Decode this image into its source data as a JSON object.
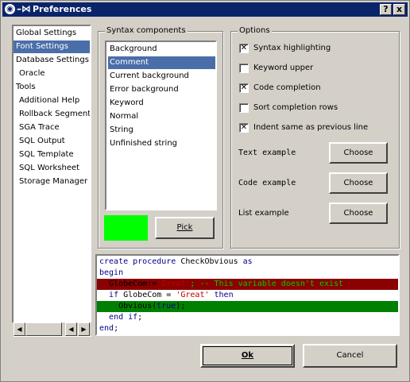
{
  "window": {
    "title": "Preferences",
    "help_button": "?",
    "close_button": "x"
  },
  "nav": {
    "items": [
      {
        "label": "Global Settings"
      },
      {
        "label": "Font Settings"
      },
      {
        "label": "Database Settings"
      },
      {
        "label": "Oracle"
      },
      {
        "label": "Tools"
      },
      {
        "label": "Additional Help"
      },
      {
        "label": "Rollback Segments"
      },
      {
        "label": "SGA Trace"
      },
      {
        "label": "SQL Output"
      },
      {
        "label": "SQL Template"
      },
      {
        "label": "SQL Worksheet"
      },
      {
        "label": "Storage Manager"
      }
    ],
    "selected": "Font Settings"
  },
  "syntax": {
    "group_title": "Syntax components",
    "items": [
      {
        "label": "Background"
      },
      {
        "label": "Comment"
      },
      {
        "label": "Current background"
      },
      {
        "label": "Error background"
      },
      {
        "label": "Keyword"
      },
      {
        "label": "Normal"
      },
      {
        "label": "String"
      },
      {
        "label": "Unfinished string"
      }
    ],
    "selected": "Comment",
    "color_swatch": "#00ff00",
    "pick_label": "Pick"
  },
  "options": {
    "group_title": "Options",
    "checkboxes": [
      {
        "label": "Syntax highlighting",
        "checked": true
      },
      {
        "label": "Keyword upper",
        "checked": false
      },
      {
        "label": "Code completion",
        "checked": true
      },
      {
        "label": "Sort completion rows",
        "checked": false
      },
      {
        "label": "Indent same as previous line",
        "checked": true
      }
    ],
    "text_example_label": "Text example",
    "code_example_label": "Code example",
    "list_example_label": "List example",
    "choose_label": "Choose"
  },
  "preview": {
    "lines": [
      {
        "kind": "normal",
        "segments": [
          {
            "t": "create procedure ",
            "c": "kw"
          },
          {
            "t": "CheckObvious ",
            "c": ""
          },
          {
            "t": "as",
            "c": "kw"
          }
        ]
      },
      {
        "kind": "normal",
        "segments": [
          {
            "t": "begin",
            "c": "kw"
          }
        ]
      },
      {
        "kind": "error",
        "segments": [
          {
            "t": "  GlobeCom:=",
            "c": ""
          },
          {
            "t": "'Great'",
            "c": "str"
          },
          {
            "t": "; -- This variable doesn't exist",
            "c": "cmt"
          }
        ]
      },
      {
        "kind": "normal",
        "segments": [
          {
            "t": "  ",
            "c": ""
          },
          {
            "t": "if ",
            "c": "kw"
          },
          {
            "t": "GlobeCom = ",
            "c": ""
          },
          {
            "t": "'Great' ",
            "c": "str"
          },
          {
            "t": "then",
            "c": "kw"
          }
        ]
      },
      {
        "kind": "current",
        "segments": [
          {
            "t": "    Obvious(",
            "c": ""
          },
          {
            "t": "true",
            "c": "kw"
          },
          {
            "t": ");",
            "c": ""
          }
        ]
      },
      {
        "kind": "normal",
        "segments": [
          {
            "t": "  ",
            "c": ""
          },
          {
            "t": "end if",
            "c": "kw"
          },
          {
            "t": ";",
            "c": ""
          }
        ]
      },
      {
        "kind": "normal",
        "segments": [
          {
            "t": "end",
            "c": "kw"
          },
          {
            "t": ";",
            "c": ""
          }
        ]
      }
    ]
  },
  "footer": {
    "ok_label": "Ok",
    "cancel_label": "Cancel"
  },
  "colors": {
    "titlebar": "#0a246a",
    "selection": "#4a6ea9",
    "error_background": "#8b0000",
    "current_background": "#008000",
    "keyword": "#00008b",
    "string": "#c00000",
    "comment": "#00cc00"
  }
}
